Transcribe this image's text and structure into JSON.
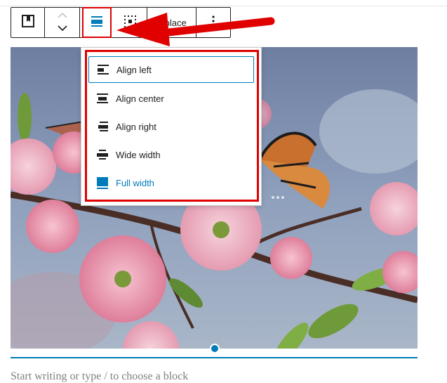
{
  "toolbar": {
    "replace_label": "Replace"
  },
  "align_menu": {
    "items": [
      {
        "label": "Align left",
        "icon": "align-left-icon"
      },
      {
        "label": "Align center",
        "icon": "align-center-icon"
      },
      {
        "label": "Align right",
        "icon": "align-right-icon"
      },
      {
        "label": "Wide width",
        "icon": "wide-width-icon"
      },
      {
        "label": "Full width",
        "icon": "full-width-icon"
      }
    ],
    "active_color": "#007cba"
  },
  "editor": {
    "placeholder": "Start writing or type / to choose a block"
  },
  "colors": {
    "accent": "#007cba",
    "annotation": "#e00000"
  }
}
